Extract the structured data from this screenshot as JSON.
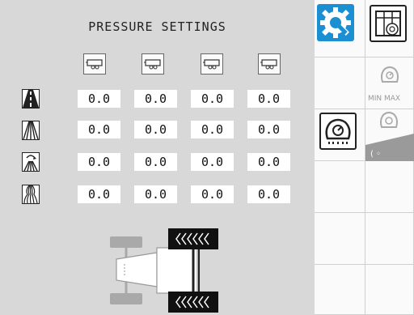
{
  "panel": {
    "title": "PRESSURE SETTINGS",
    "trailer_icons": [
      "trailer-icon",
      "trailer-icon",
      "trailer-icon",
      "trailer-icon"
    ],
    "rows": [
      {
        "surface_icon": "road-icon",
        "values": [
          "0.0",
          "0.0",
          "0.0",
          "0.0"
        ]
      },
      {
        "surface_icon": "field-icon",
        "values": [
          "0.0",
          "0.0",
          "0.0",
          "0.0"
        ]
      },
      {
        "surface_icon": "field-turn-icon",
        "values": [
          "0.0",
          "0.0",
          "0.0",
          "0.0"
        ]
      },
      {
        "surface_icon": "soft-soil-icon",
        "values": [
          "0.0",
          "0.0",
          "0.0",
          "0.0"
        ]
      }
    ]
  },
  "side_menu": {
    "min_max_label": "MIN MAX",
    "accent_color": "#1b8fd1"
  }
}
